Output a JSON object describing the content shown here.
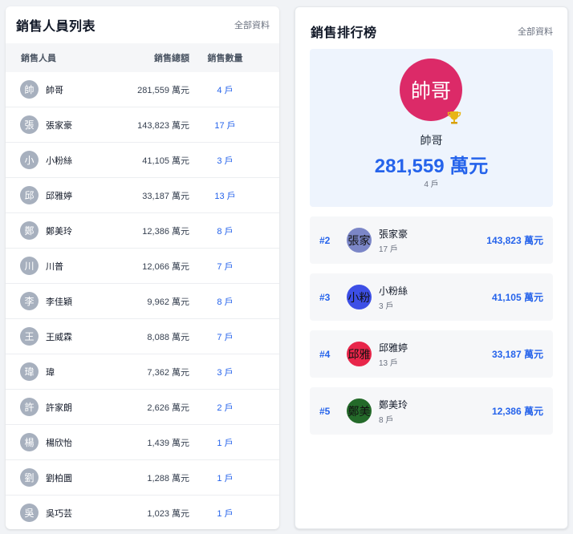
{
  "list": {
    "title": "銷售人員列表",
    "link": "全部資料",
    "headers": {
      "name": "銷售人員",
      "amount": "銷售總額",
      "count": "銷售數量"
    },
    "rows": [
      {
        "avatar": "帥",
        "name": "帥哥",
        "amount": "281,559 萬元",
        "count": "4 戶"
      },
      {
        "avatar": "張",
        "name": "張家豪",
        "amount": "143,823 萬元",
        "count": "17 戶"
      },
      {
        "avatar": "小",
        "name": "小粉絲",
        "amount": "41,105 萬元",
        "count": "3 戶"
      },
      {
        "avatar": "邱",
        "name": "邱雅婷",
        "amount": "33,187 萬元",
        "count": "13 戶"
      },
      {
        "avatar": "鄭",
        "name": "鄭美玲",
        "amount": "12,386 萬元",
        "count": "8 戶"
      },
      {
        "avatar": "川",
        "name": "川普",
        "amount": "12,066 萬元",
        "count": "7 戶"
      },
      {
        "avatar": "李",
        "name": "李佳穎",
        "amount": "9,962 萬元",
        "count": "8 戶"
      },
      {
        "avatar": "王",
        "name": "王威霖",
        "amount": "8,088 萬元",
        "count": "7 戶"
      },
      {
        "avatar": "瑋",
        "name": "瑋",
        "amount": "7,362 萬元",
        "count": "3 戶"
      },
      {
        "avatar": "許",
        "name": "許家朗",
        "amount": "2,626 萬元",
        "count": "2 戶"
      },
      {
        "avatar": "楊",
        "name": "楊欣怡",
        "amount": "1,439 萬元",
        "count": "1 戶"
      },
      {
        "avatar": "劉",
        "name": "劉柏圜",
        "amount": "1,288 萬元",
        "count": "1 戶"
      },
      {
        "avatar": "吳",
        "name": "吳巧芸",
        "amount": "1,023 萬元",
        "count": "1 戶"
      }
    ]
  },
  "ranking": {
    "title": "銷售排行榜",
    "link": "全部資料",
    "winner": {
      "avatar": "帥哥",
      "avatar_color": "#dc2a68",
      "icon": "trophy-icon",
      "name": "帥哥",
      "amount": "281,559 萬元",
      "count": "4 戶"
    },
    "others": [
      {
        "rank": "#2",
        "avatar": "張家",
        "avatar_color": "#7b86c7",
        "name": "張家豪",
        "count": "17 戶",
        "amount": "143,823 萬元"
      },
      {
        "rank": "#3",
        "avatar": "小粉",
        "avatar_color": "#3d4fe6",
        "name": "小粉絲",
        "count": "3 戶",
        "amount": "41,105 萬元"
      },
      {
        "rank": "#4",
        "avatar": "邱雅",
        "avatar_color": "#e8264a",
        "name": "邱雅婷",
        "count": "13 戶",
        "amount": "33,187 萬元"
      },
      {
        "rank": "#5",
        "avatar": "鄭美",
        "avatar_color": "#246a2a",
        "name": "鄭美玲",
        "count": "8 戶",
        "amount": "12,386 萬元"
      }
    ]
  },
  "colors": {
    "accent": "#2563eb",
    "avatar_gray": "#a7b0be"
  }
}
